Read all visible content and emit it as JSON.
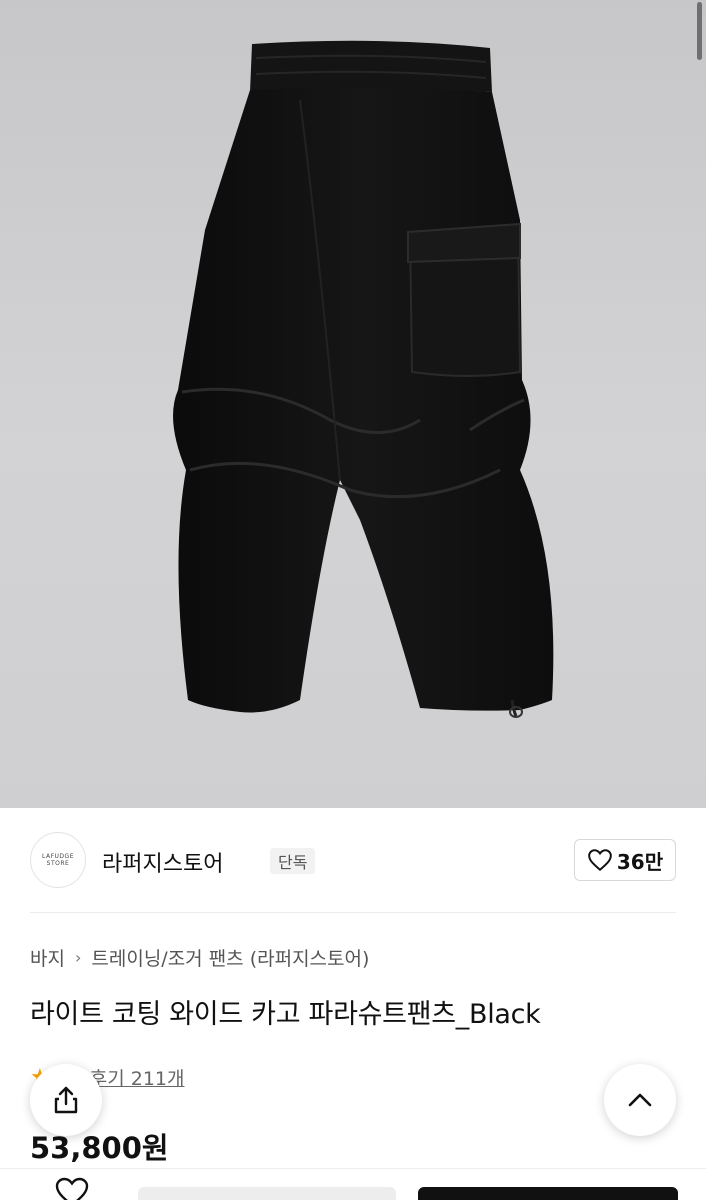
{
  "brand": {
    "logo_text": "LAFUDGE STORE",
    "name": "라퍼지스토어",
    "badge": "단독",
    "like_count": "36만"
  },
  "breadcrumb": {
    "category": "바지",
    "subcategory": "트레이닝/조거 팬츠 (라퍼지스토어)"
  },
  "product": {
    "title": "라이트 코팅 와이드 카고 파라슈트팬츠_Black",
    "reviews": "후기 211개",
    "price": "53,800원"
  },
  "icons": {
    "like": "heart-icon",
    "share": "share-icon",
    "scroll_top": "chevron-up-icon",
    "rating": "star-icon"
  },
  "colors": {
    "accent_star": "#f5a000",
    "buy_button": "#111111"
  }
}
